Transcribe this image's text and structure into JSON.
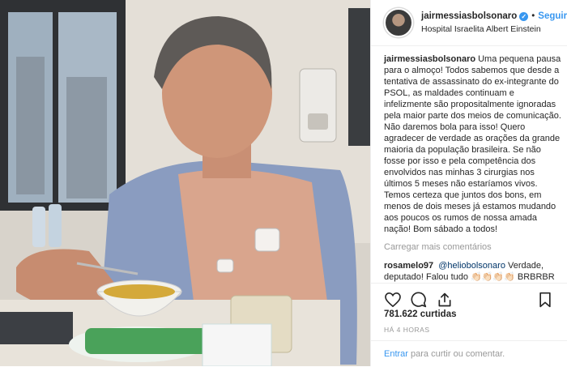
{
  "header": {
    "username": "jairmessiasbolsonaro",
    "follow_label": "Seguir",
    "location": "Hospital Israelita Albert Einstein"
  },
  "caption": {
    "username": "jairmessiasbolsonaro",
    "text": "Uma pequena pausa para o almoço! Todos sabemos que desde a tentativa de assassinato do ex-integrante do PSOL, as maldades continuam e infelizmente são propositalmente ignoradas pela maior parte dos meios de comunicação. Não daremos bola para isso! Quero agradecer de verdade as orações da grande maioria da população brasileira. Se não fosse por isso e pela competência dos envolvidos nas minhas 3 cirurgias nos últimos 5 meses não estaríamos vivos. Temos certeza que juntos dos bons, em menos de dois meses já estamos mudando aos poucos os rumos de nossa amada nação! Bom sábado a todos!"
  },
  "load_more": "Carregar mais comentários",
  "comment": {
    "username": "rosamelo97",
    "mention": "@heliobolsonaro",
    "text": "Verdade, deputado! Falou tudo 👏🏻👏🏻👏🏻👏🏻 BRBRBR"
  },
  "icons": [
    "heart-icon",
    "comment-icon",
    "share-icon",
    "bookmark-icon",
    "verified-icon"
  ],
  "likes": "781.622 curtidas",
  "time": "HÁ 4 HORAS",
  "add_comment": {
    "link": "Entrar",
    "text": " para curtir ou comentar."
  },
  "colors": {
    "link": "#3897f0",
    "muted": "#999999",
    "border": "#efefef"
  }
}
